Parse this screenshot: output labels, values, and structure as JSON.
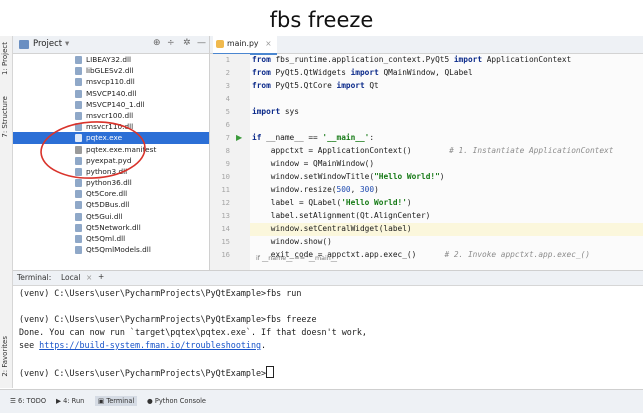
{
  "caption": "fbs freeze",
  "left_strip": {
    "project_label": "1: Project",
    "structure_label": "7: Structure",
    "favorites_label": "2: Favorites"
  },
  "project_panel": {
    "title": "Project",
    "files": [
      {
        "name": "LIBEAY32.dll",
        "kind": "dll"
      },
      {
        "name": "libGLESv2.dll",
        "kind": "dll"
      },
      {
        "name": "msvcp110.dll",
        "kind": "dll"
      },
      {
        "name": "MSVCP140.dll",
        "kind": "dll"
      },
      {
        "name": "MSVCP140_1.dll",
        "kind": "dll"
      },
      {
        "name": "msvcr100.dll",
        "kind": "dll"
      },
      {
        "name": "msvcr110.dll",
        "kind": "dll"
      },
      {
        "name": "pqtex.exe",
        "kind": "exe",
        "selected": true
      },
      {
        "name": "pqtex.exe.manifest",
        "kind": "file"
      },
      {
        "name": "pyexpat.pyd",
        "kind": "pyd"
      },
      {
        "name": "python3.dll",
        "kind": "dll"
      },
      {
        "name": "python36.dll",
        "kind": "dll"
      },
      {
        "name": "Qt5Core.dll",
        "kind": "dll"
      },
      {
        "name": "Qt5DBus.dll",
        "kind": "dll"
      },
      {
        "name": "Qt5Gui.dll",
        "kind": "dll"
      },
      {
        "name": "Qt5Network.dll",
        "kind": "dll"
      },
      {
        "name": "Qt5Qml.dll",
        "kind": "dll"
      },
      {
        "name": "Qt5QmlModels.dll",
        "kind": "dll"
      }
    ]
  },
  "editor": {
    "tab_label": "main.py",
    "line_numbers": [
      "1",
      "2",
      "3",
      "4",
      "5",
      "6",
      "7",
      "8",
      "9",
      "10",
      "11",
      "12",
      "13",
      "14",
      "15",
      "16"
    ],
    "breadcrumb": "if __name__ == '__main__'",
    "highlight_line": 14
  },
  "terminal": {
    "label": "Terminal:",
    "tab": "Local",
    "add": "+",
    "line1": "(venv) C:\\Users\\user\\PycharmProjects\\PyQtExample>fbs run",
    "line2": "(venv) C:\\Users\\user\\PycharmProjects\\PyQtExample>fbs freeze",
    "line3": "Done. You can now run `target\\pqtex\\pqtex.exe`. If that doesn't work,",
    "line4_prefix": "see ",
    "line4_link": "https://build-system.fman.io/troubleshooting",
    "line4_suffix": ".",
    "line5": "(venv) C:\\Users\\user\\PycharmProjects\\PyQtExample>"
  },
  "bottom_bar": {
    "todo": "6: TODO",
    "run": "4: Run",
    "terminal": "Terminal",
    "console": "Python Console"
  },
  "colors": {
    "selection": "#2c6fd6",
    "annotation": "#d9332b",
    "keyword": "#0b2a8a",
    "string": "#167a16"
  }
}
